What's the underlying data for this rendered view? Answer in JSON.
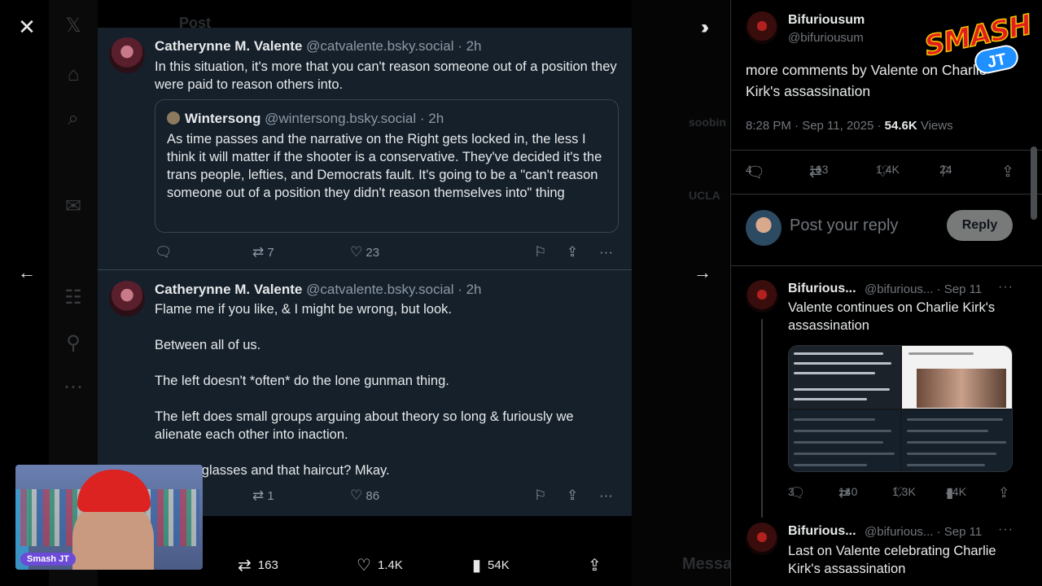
{
  "viewer": {
    "close_icon": "close-icon",
    "prev_icon": "arrow-left-icon",
    "next_icon": "arrow-right-icon",
    "collapse_icon": "double-chevron-right-icon"
  },
  "background": {
    "header_title": "Post",
    "right_ghost": [
      "soobin",
      "UCLA",
      "Messa"
    ]
  },
  "posts": [
    {
      "author": "Catherynne M. Valente",
      "meta": "@catvalente.bsky.social · 2h",
      "text": "In this situation, it's more that you can't reason someone out of a position they were paid to reason others into.",
      "quote": {
        "author": "Wintersong",
        "meta": "@wintersong.bsky.social · 2h",
        "text": "As time passes and the narrative on the Right gets locked in, the less I think it will matter if the shooter is a conservative. They've decided it's the trans people, lefties, and Democrats fault. It's going to be a \"can't reason someone out of a position they didn't reason themselves into\" thing"
      },
      "reposts": "7",
      "likes": "23"
    },
    {
      "author": "Catherynne M. Valente",
      "meta": "@catvalente.bsky.social · 2h",
      "paragraphs": [
        "Flame me if you like, & I might be wrong, but look.",
        "Between all of us.",
        "The left doesn't *often* do the lone gunman thing.",
        "The left does small groups arguing about theory so long & furiously we alienate each other into inaction.",
        "ose sunglasses and that haircut? Mkay."
      ],
      "reposts": "1",
      "likes": "86"
    }
  ],
  "bottom_bar": {
    "reposts": "163",
    "likes": "1.4K",
    "views": "54K"
  },
  "webcam": {
    "tag": "Smash JT"
  },
  "logo": {
    "smash": "SMASH",
    "jt": "JT"
  },
  "right_panel": {
    "main": {
      "name": "Bifuriousum",
      "handle": "@bifuriousum",
      "text": "more comments by Valente on Charlie Kirk's assassination",
      "time": "8:28 PM · Sep 11, 2025 · ",
      "views_count": "54.6K",
      "views_label": " Views",
      "replies": "4",
      "reposts": "163",
      "likes": "1.4K",
      "bookmarks": "24"
    },
    "reply_box": {
      "placeholder": "Post your reply",
      "button": "Reply"
    },
    "thread": [
      {
        "name": "Bifurious...",
        "meta": "@bifurious... · Sep 11",
        "text": "Valente continues on Charlie Kirk's assassination",
        "replies": "3",
        "reposts": "140",
        "likes": "1.3K",
        "views": "44K"
      },
      {
        "name": "Bifurious...",
        "meta": "@bifurious... · Sep 11",
        "text": "Last on Valente celebrating Charlie Kirk's assassination"
      }
    ]
  }
}
